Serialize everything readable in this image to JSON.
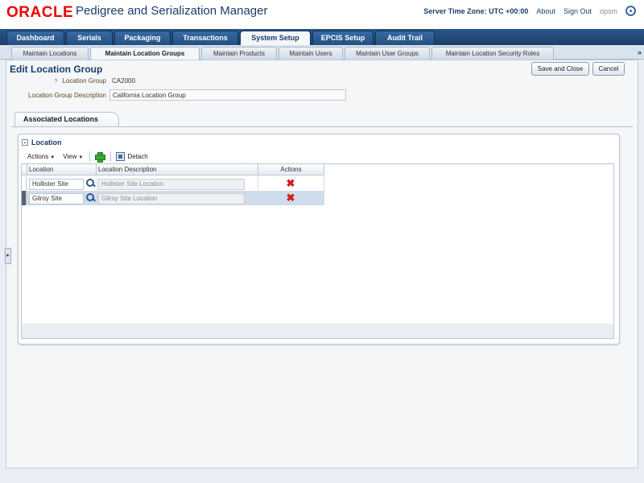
{
  "header": {
    "logo": "ORACLE",
    "app_title": "Pedigree and Serialization Manager",
    "server_time": "Server Time Zone: UTC +00:00",
    "about": "About",
    "sign_out": "Sign Out",
    "user": "opsm"
  },
  "main_tabs": [
    "Dashboard",
    "Serials",
    "Packaging",
    "Transactions",
    "System Setup",
    "EPCIS Setup",
    "Audit Trail"
  ],
  "main_tab_active": "System Setup",
  "sub_tabs": [
    "Maintain Locations",
    "Maintain Location Groups",
    "Maintain Products",
    "Maintain Users",
    "Maintain User Groups",
    "Maintain Location Security Roles"
  ],
  "sub_tab_active": "Maintain Location Groups",
  "sub_tabs_more": "»",
  "page": {
    "title": "Edit Location Group",
    "save_close": "Save and Close",
    "cancel": "Cancel",
    "required_marker": "?",
    "group_label": "Location Group",
    "group_value": "CA2000",
    "desc_label": "Location Group Description",
    "desc_value": "California Location Group"
  },
  "assoc": {
    "tab_label": "Associated Locations",
    "section_label": "Location",
    "disclose": "⌄",
    "actions_menu": "Actions",
    "view_menu": "View",
    "detach": "Detach",
    "columns": {
      "location": "Location",
      "description": "Location Description",
      "actions": "Actions"
    },
    "rows": [
      {
        "location": "Hollister Site",
        "description": "Hollister Site Location",
        "selected": false
      },
      {
        "location": "Gilroy Site",
        "description": "Gilroy Site Location",
        "selected": true
      }
    ],
    "delete_glyph": "✖"
  },
  "left_handle": "▸",
  "colors": {
    "brand": "#e00000",
    "nav": "#1c3f6a",
    "title": "#1a3d6d"
  }
}
